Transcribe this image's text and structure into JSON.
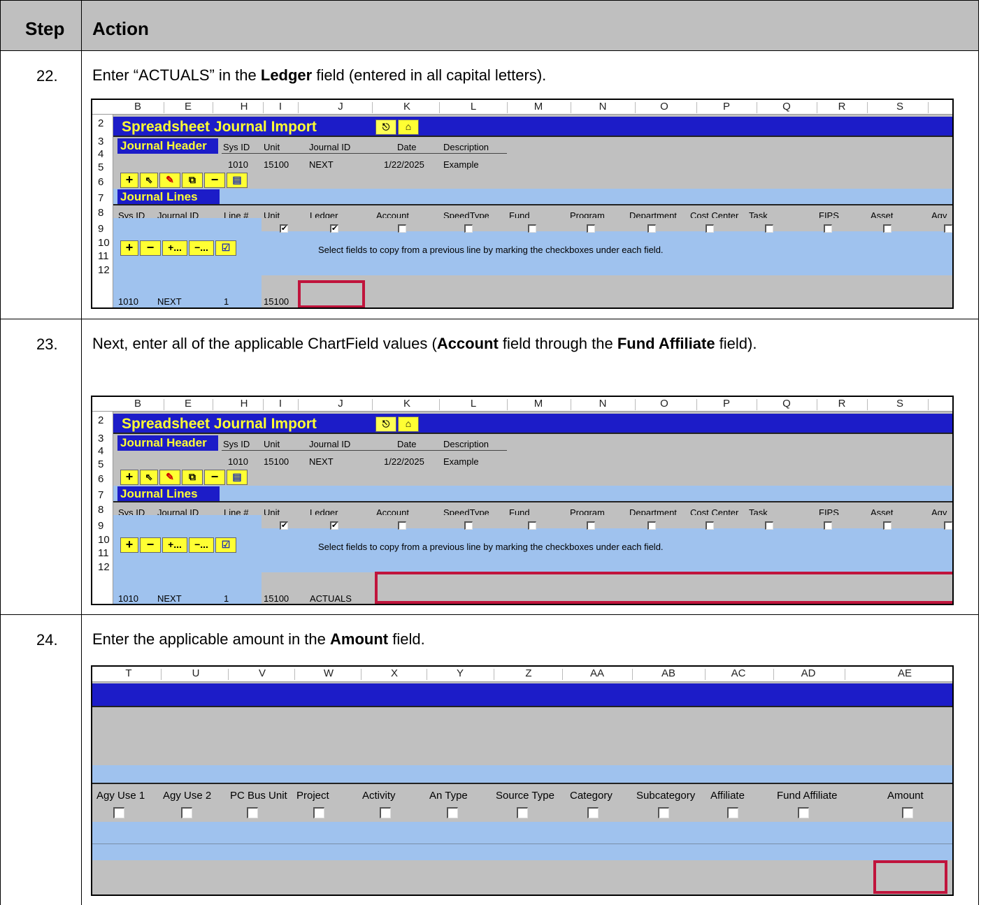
{
  "table": {
    "header": {
      "step": "Step",
      "action": "Action"
    }
  },
  "steps": [
    {
      "number": "22.",
      "parts": [
        "Enter “ACTUALS” in the ",
        "Ledger",
        " field (entered in all capital letters)."
      ]
    },
    {
      "number": "23.",
      "parts": [
        "Next, enter all of the applicable ChartField values (",
        "Account",
        " field through the ",
        "Fund Affiliate",
        " field)."
      ]
    },
    {
      "number": "24.",
      "parts": [
        "Enter the applicable amount in the ",
        "Amount",
        " field."
      ]
    }
  ],
  "sheet": {
    "columns": [
      "B",
      "E",
      "H",
      "I",
      "J",
      "K",
      "L",
      "M",
      "N",
      "O",
      "P",
      "Q",
      "R",
      "S"
    ],
    "rows": [
      "2",
      "3",
      "4",
      "5",
      "6",
      "7",
      "8",
      "9",
      "10",
      "11",
      "12"
    ],
    "title": "Spreadsheet Journal Import",
    "journal_header": "Journal Header",
    "header_labels": {
      "sys_id": "Sys ID",
      "unit": "Unit",
      "journal_id": "Journal ID",
      "date": "Date",
      "description": "Description"
    },
    "header_values": {
      "sys_id": "1010",
      "unit": "15100",
      "journal_id": "NEXT",
      "date": "1/22/2025",
      "description": "Example"
    },
    "journal_lines": "Journal Lines",
    "line_fields": [
      "Sys ID",
      "Journal ID",
      "Line #",
      "Unit",
      "Ledger",
      "Account",
      "SpeedType",
      "Fund",
      "Program",
      "Department",
      "Cost Center",
      "Task",
      "FIPS",
      "Asset",
      "Agy"
    ],
    "copy_hint": "Select fields to copy from a previous line by marking the checkboxes under each field.",
    "line_values": {
      "sys_id": "1010",
      "journal_id": "NEXT",
      "line": "1",
      "unit": "15100",
      "ledger": "ACTUALS"
    },
    "toolbar_row5": [
      "+",
      "⇖",
      "✎",
      "⧉",
      "−",
      "▤"
    ],
    "toolbar_row9": [
      "+",
      "−",
      "+...",
      "−...",
      "☑"
    ],
    "check_mark": "✔"
  },
  "sheet2": {
    "columns": [
      "T",
      "U",
      "V",
      "W",
      "X",
      "Y",
      "Z",
      "AA",
      "AB",
      "AC",
      "AD",
      "AE"
    ],
    "fields": [
      "Agy Use 1",
      "Agy Use 2",
      "PC Bus Unit",
      "Project",
      "Activity",
      "An Type",
      "Source Type",
      "Category",
      "Subcategory",
      "Affiliate",
      "Fund Affiliate",
      "Amount"
    ]
  },
  "colors": {
    "title_bar": "#1c1cc8",
    "title_text": "#ffff33",
    "light_blue": "#9fc2ee",
    "gray": "#c0c0c0",
    "highlight": "#c0143c",
    "table_header": "#bfbfbf"
  }
}
